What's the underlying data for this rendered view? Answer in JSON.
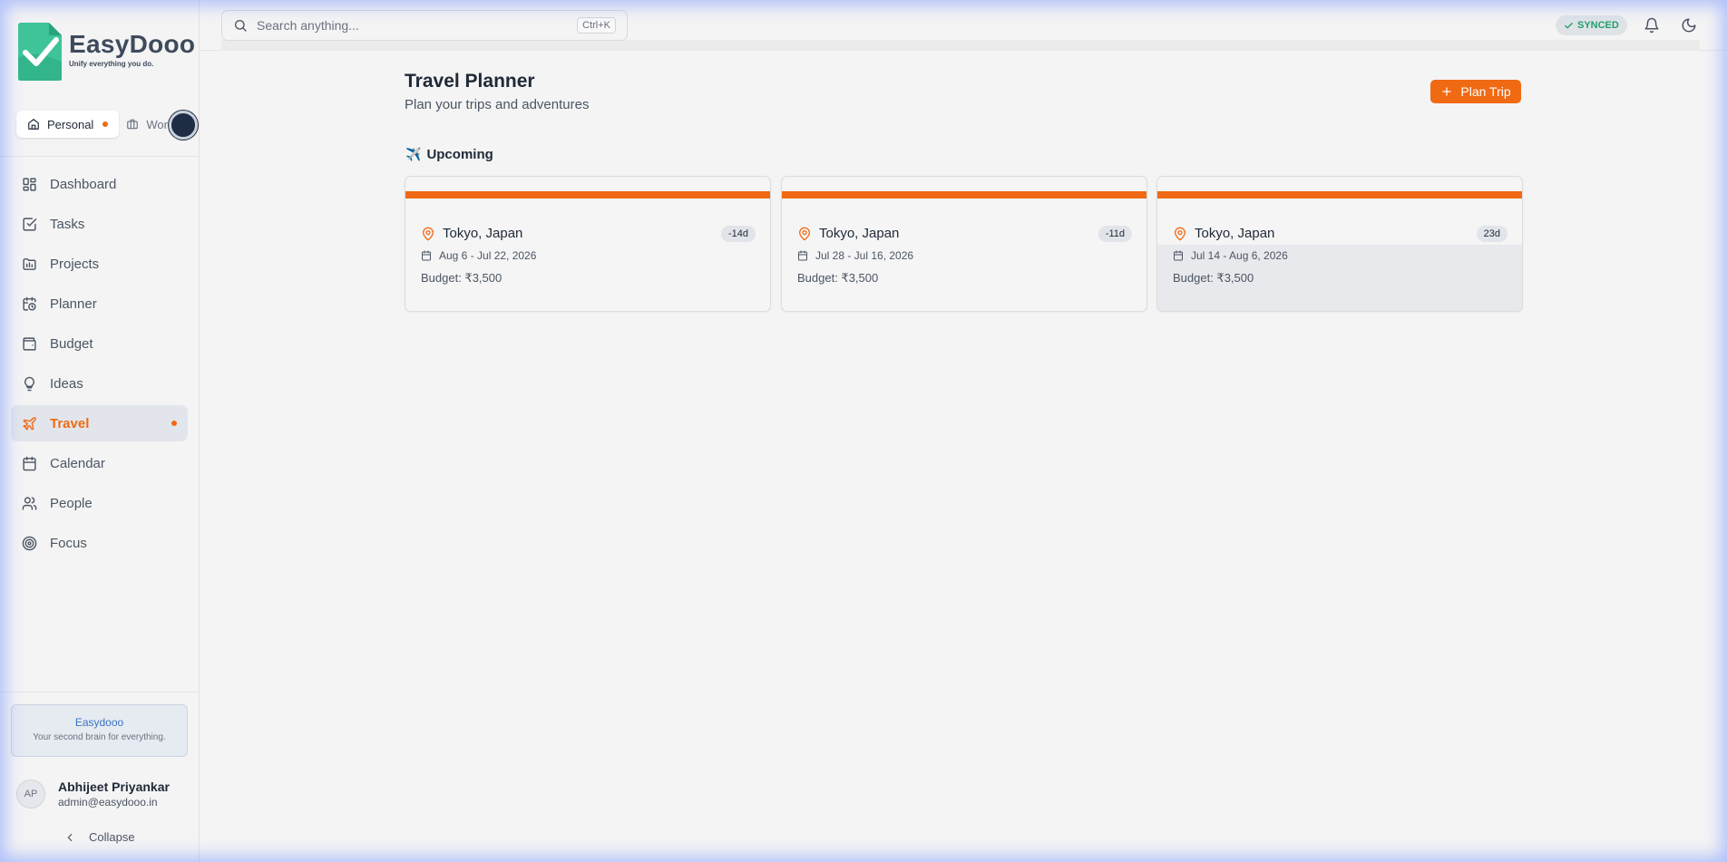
{
  "brand": {
    "name": "EasyDooo",
    "tagline": "Unify everything you do."
  },
  "workspaces": [
    {
      "label": "Personal",
      "active": true,
      "icon": "home-icon"
    },
    {
      "label": "Work",
      "active": false,
      "icon": "briefcase-icon"
    }
  ],
  "nav": [
    {
      "label": "Dashboard",
      "icon": "dashboard-icon"
    },
    {
      "label": "Tasks",
      "icon": "tasks-icon"
    },
    {
      "label": "Projects",
      "icon": "projects-icon"
    },
    {
      "label": "Planner",
      "icon": "planner-icon"
    },
    {
      "label": "Budget",
      "icon": "wallet-icon"
    },
    {
      "label": "Ideas",
      "icon": "lightbulb-icon"
    },
    {
      "label": "Travel",
      "icon": "plane-icon",
      "active": true
    },
    {
      "label": "Calendar",
      "icon": "calendar-icon"
    },
    {
      "label": "People",
      "icon": "people-icon"
    },
    {
      "label": "Focus",
      "icon": "target-icon"
    }
  ],
  "promo": {
    "title": "Easydooo",
    "subtitle": "Your second brain for everything."
  },
  "user": {
    "initials": "AP",
    "name": "Abhijeet Priyankar",
    "email": "admin@easydooo.in"
  },
  "collapse_label": "Collapse",
  "search": {
    "placeholder": "Search anything...",
    "shortcut": "Ctrl+K"
  },
  "sync_status": "SYNCED",
  "page": {
    "title": "Travel Planner",
    "subtitle": "Plan your trips and adventures",
    "action_label": "Plan Trip"
  },
  "section": {
    "emoji": "✈️",
    "title": "Upcoming"
  },
  "trips": [
    {
      "destination": "Tokyo, Japan",
      "days": "-14d",
      "dates": "Aug 6 - Jul 22, 2026",
      "budget": "Budget: ₹3,500"
    },
    {
      "destination": "Tokyo, Japan",
      "days": "-11d",
      "dates": "Jul 28 - Jul 16, 2026",
      "budget": "Budget: ₹3,500"
    },
    {
      "destination": "Tokyo, Japan",
      "days": "23d",
      "dates": "Jul 14 - Aug 6, 2026",
      "budget": "Budget: ₹3,500"
    }
  ],
  "colors": {
    "accent": "#f06a14",
    "synced": "#22a06b",
    "promo_title": "#3b73c4"
  }
}
